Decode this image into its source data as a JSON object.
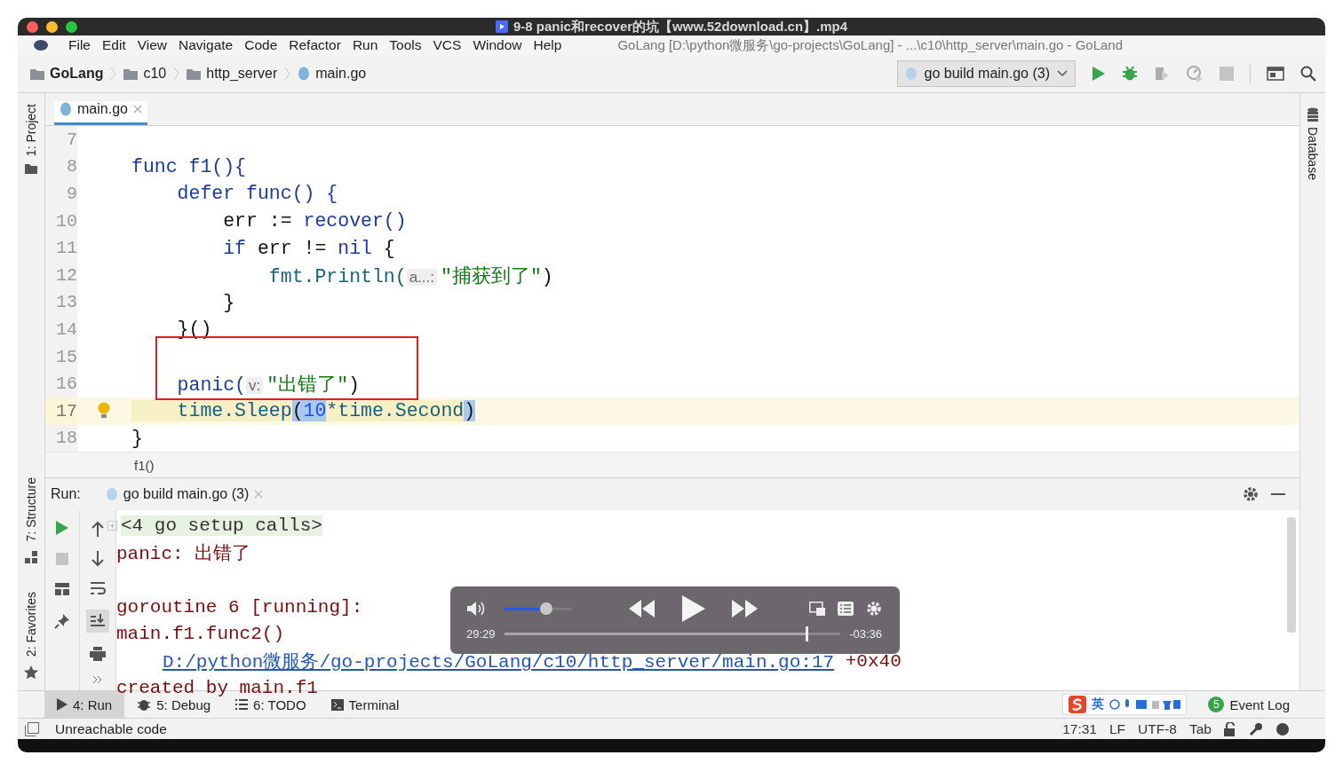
{
  "player": {
    "title": "9-8 panic和recover的坑【www.52download.cn】.mp4",
    "elapsed": "29:29",
    "remaining": "-03:36",
    "volume": {
      "level": 0.62
    },
    "progress": {
      "level": 0.9
    }
  },
  "menu": [
    "File",
    "Edit",
    "View",
    "Navigate",
    "Code",
    "Refactor",
    "Run",
    "Tools",
    "VCS",
    "Window",
    "Help"
  ],
  "window_title": "GoLang [D:\\python微服务\\go-projects\\GoLang] - ...\\c10\\http_server\\main.go - GoLand",
  "breadcrumbs": [
    {
      "label": "GoLang",
      "kind": "folder"
    },
    {
      "label": "c10",
      "kind": "folder"
    },
    {
      "label": "http_server",
      "kind": "folder"
    },
    {
      "label": "main.go",
      "kind": "file"
    }
  ],
  "run_config": "go build main.go (3)",
  "editor_tabs": [
    {
      "label": "main.go",
      "selected": true
    }
  ],
  "left_strip": {
    "top": [
      "1: Project"
    ],
    "bottom": [
      "7: Structure",
      "2: Favorites"
    ]
  },
  "right_strip": [
    "Database"
  ],
  "code": {
    "lines": [
      {
        "number": "7",
        "current": false
      },
      {
        "number": "8",
        "current": false,
        "tokens": [
          {
            "t": "func f1(){",
            "kind": "kw"
          }
        ]
      },
      {
        "number": "9",
        "current": false,
        "tokens": [
          {
            "t": "    defer func() {",
            "kind": "kw"
          }
        ]
      },
      {
        "number": "10",
        "current": false,
        "tokens": [
          {
            "t": "        err := ",
            "kind": "plain"
          },
          {
            "t": "recover()",
            "kind": "kw"
          }
        ]
      },
      {
        "number": "11",
        "current": false,
        "tokens": [
          {
            "t": "        if",
            "kind": "kw"
          },
          {
            "t": " err != ",
            "kind": "plain"
          },
          {
            "t": "nil",
            "kind": "kw"
          },
          {
            "t": " {",
            "kind": "plain"
          }
        ]
      },
      {
        "number": "12",
        "current": false,
        "tokens": [
          {
            "t": "            fmt.Println(",
            "kind": "fn"
          },
          {
            "t": "a...:",
            "kind": "hint"
          },
          {
            "t": "\"捕获到了\"",
            "kind": "str"
          },
          {
            "t": ")",
            "kind": "plain"
          }
        ]
      },
      {
        "number": "13",
        "current": false,
        "tokens": [
          {
            "t": "        }",
            "kind": "plain"
          }
        ]
      },
      {
        "number": "14",
        "current": false,
        "tokens": [
          {
            "t": "    }()",
            "kind": "plain"
          }
        ]
      },
      {
        "number": "15",
        "current": false
      },
      {
        "number": "16",
        "current": false,
        "boxed": true,
        "tokens": [
          {
            "t": "    panic(",
            "kind": "kw"
          },
          {
            "t": "v:",
            "kind": "hint"
          },
          {
            "t": "\"出错了\"",
            "kind": "str"
          },
          {
            "t": ")",
            "kind": "plain"
          }
        ]
      },
      {
        "number": "17",
        "current": true,
        "bulb": true,
        "tokens": [
          {
            "t": "    time.Sleep",
            "kind": "fn"
          },
          {
            "t": "(",
            "kind": "match"
          },
          {
            "t": "10",
            "kind": "num"
          },
          {
            "t": "*time.Second",
            "kind": "fn"
          },
          {
            "t": ")",
            "kind": "match"
          }
        ]
      },
      {
        "number": "18",
        "current": false,
        "tokens": [
          {
            "t": "}",
            "kind": "plain"
          }
        ]
      }
    ],
    "breadcrumb": "f1()"
  },
  "run_panel": {
    "label": "Run:",
    "tab": "go build main.go (3)",
    "console": [
      {
        "kind": "fold",
        "text": "<4 go setup calls>"
      },
      {
        "kind": "err",
        "text": "panic: 出错了"
      },
      {
        "kind": "blank"
      },
      {
        "kind": "err",
        "text": "goroutine 6 [running]:"
      },
      {
        "kind": "err",
        "text": "main.f1.func2()"
      },
      {
        "kind": "link",
        "text": "D:/python微服务/go-projects/GoLang/c10/http_server/main.go:17",
        "suffix": " +0x40"
      },
      {
        "kind": "err",
        "text": "created by main.f1"
      }
    ]
  },
  "tool_window_tabs": [
    {
      "label": "4: Run",
      "kind": "run",
      "selected": true
    },
    {
      "label": "5: Debug",
      "kind": "debug",
      "selected": false
    },
    {
      "label": "6: TODO",
      "kind": "todo",
      "selected": false
    },
    {
      "label": "Terminal",
      "kind": "terminal",
      "selected": false
    }
  ],
  "event_log": {
    "badge": "5",
    "label": "Event Log"
  },
  "ime": {
    "label": "英"
  },
  "status": {
    "message": "Unreachable code",
    "items": [
      "17:31",
      "LF",
      "UTF-8",
      "Tab"
    ]
  }
}
